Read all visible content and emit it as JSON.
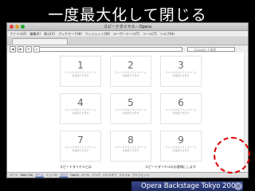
{
  "headline": "一度最大化して閉じる",
  "window": {
    "title": "スピードダイヤル - Opera"
  },
  "menu": [
    "ファイル(F)",
    "編集(E)",
    "表示(V)",
    "ブックマーク(B)",
    "ウィジェット(W)",
    "ユーザーツール(T)",
    "ツール(T)",
    "ヘルプ(H)"
  ],
  "search_placeholder": "Google で検索",
  "speed_dial": {
    "cells": [
      {
        "number": "1",
        "line1": "クリックするとウェブページ",
        "line2": "を追加できます"
      },
      {
        "number": "2",
        "line1": "クリックするとウェブページ",
        "line2": "を追加できます"
      },
      {
        "number": "3",
        "line1": "クリックするとウェブページ",
        "line2": "を追加できます"
      },
      {
        "number": "4",
        "line1": "クリックするとウェブページ",
        "line2": "を追加できます"
      },
      {
        "number": "5",
        "line1": "クリックするとウェブページ",
        "line2": "を追加できます"
      },
      {
        "number": "6",
        "line1": "クリックするとウェブページ",
        "line2": "を追加できます"
      },
      {
        "number": "7",
        "line1": "クリックするとウェブページ",
        "line2": "を追加できます"
      },
      {
        "number": "8",
        "line1": "クリックするとウェブページ",
        "line2": "を追加できます"
      },
      {
        "number": "9",
        "line1": "クリックするとウェブページ",
        "line2": "を追加できます"
      }
    ],
    "footer_left": "スピードダイヤルとは",
    "footer_right": "スピードダイヤルのお客様にします"
  },
  "statusbar": [
    "ページ",
    "Web (3b)",
    "ホーム",
    "ニュース",
    "ブログ",
    "Opera",
    "メール",
    "リンク",
    "ハンドオフ",
    "ファイル",
    "ウィジェット"
  ],
  "banner": "Opera Backstage Tokyo 2008",
  "close_glyph": "×",
  "nav_icons": {
    "back": "◀",
    "forward": "▶",
    "reload": "↻",
    "home": "⌂"
  }
}
